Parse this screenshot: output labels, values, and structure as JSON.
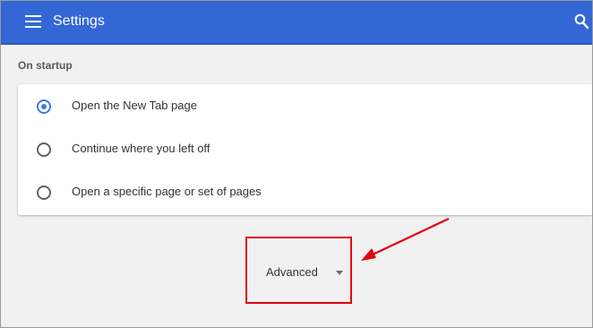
{
  "header": {
    "title": "Settings",
    "accent_color": "#3367d6",
    "menu_icon": "hamburger-menu-icon",
    "search_icon": "search-icon"
  },
  "startup": {
    "section_title": "On startup",
    "options": [
      {
        "label": "Open the New Tab page",
        "selected": true
      },
      {
        "label": "Continue where you left off",
        "selected": false
      },
      {
        "label": "Open a specific page or set of pages",
        "selected": false
      }
    ],
    "radio_color": "#3f7cdc"
  },
  "advanced": {
    "label": "Advanced",
    "caret_icon": "caret-down-icon",
    "highlight_color": "#e3000f"
  }
}
